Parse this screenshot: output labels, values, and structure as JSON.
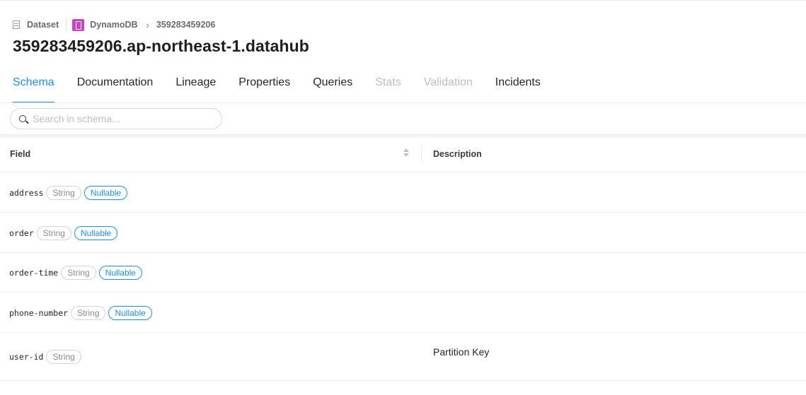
{
  "breadcrumb": {
    "entity_type": "Dataset",
    "platform": "DynamoDB",
    "current": "359283459206"
  },
  "title": "359283459206.ap-northeast-1.datahub",
  "tabs": [
    {
      "label": "Schema",
      "state": "active"
    },
    {
      "label": "Documentation",
      "state": "enabled"
    },
    {
      "label": "Lineage",
      "state": "enabled"
    },
    {
      "label": "Properties",
      "state": "enabled"
    },
    {
      "label": "Queries",
      "state": "enabled"
    },
    {
      "label": "Stats",
      "state": "disabled"
    },
    {
      "label": "Validation",
      "state": "disabled"
    },
    {
      "label": "Incidents",
      "state": "enabled"
    }
  ],
  "search": {
    "placeholder": "Search in schema...",
    "value": ""
  },
  "table": {
    "headers": {
      "field": "Field",
      "description": "Description"
    },
    "rows": [
      {
        "field": "address",
        "type": "String",
        "nullable": "Nullable",
        "description": ""
      },
      {
        "field": "order",
        "type": "String",
        "nullable": "Nullable",
        "description": ""
      },
      {
        "field": "order-time",
        "type": "String",
        "nullable": "Nullable",
        "description": ""
      },
      {
        "field": "phone-number",
        "type": "String",
        "nullable": "Nullable",
        "description": ""
      },
      {
        "field": "user-id",
        "type": "String",
        "description": "Partition Key"
      }
    ]
  },
  "colors": {
    "accent": "#1890ff",
    "platform_icon": "#c945c6",
    "disabled_tab": "#bdbdbd"
  },
  "icons": {
    "entity_type": "dataset-icon",
    "platform": "dynamodb-icon",
    "breadcrumb_separator": "chevron-right-icon",
    "search": "search-icon",
    "sort": "sort-icon"
  }
}
